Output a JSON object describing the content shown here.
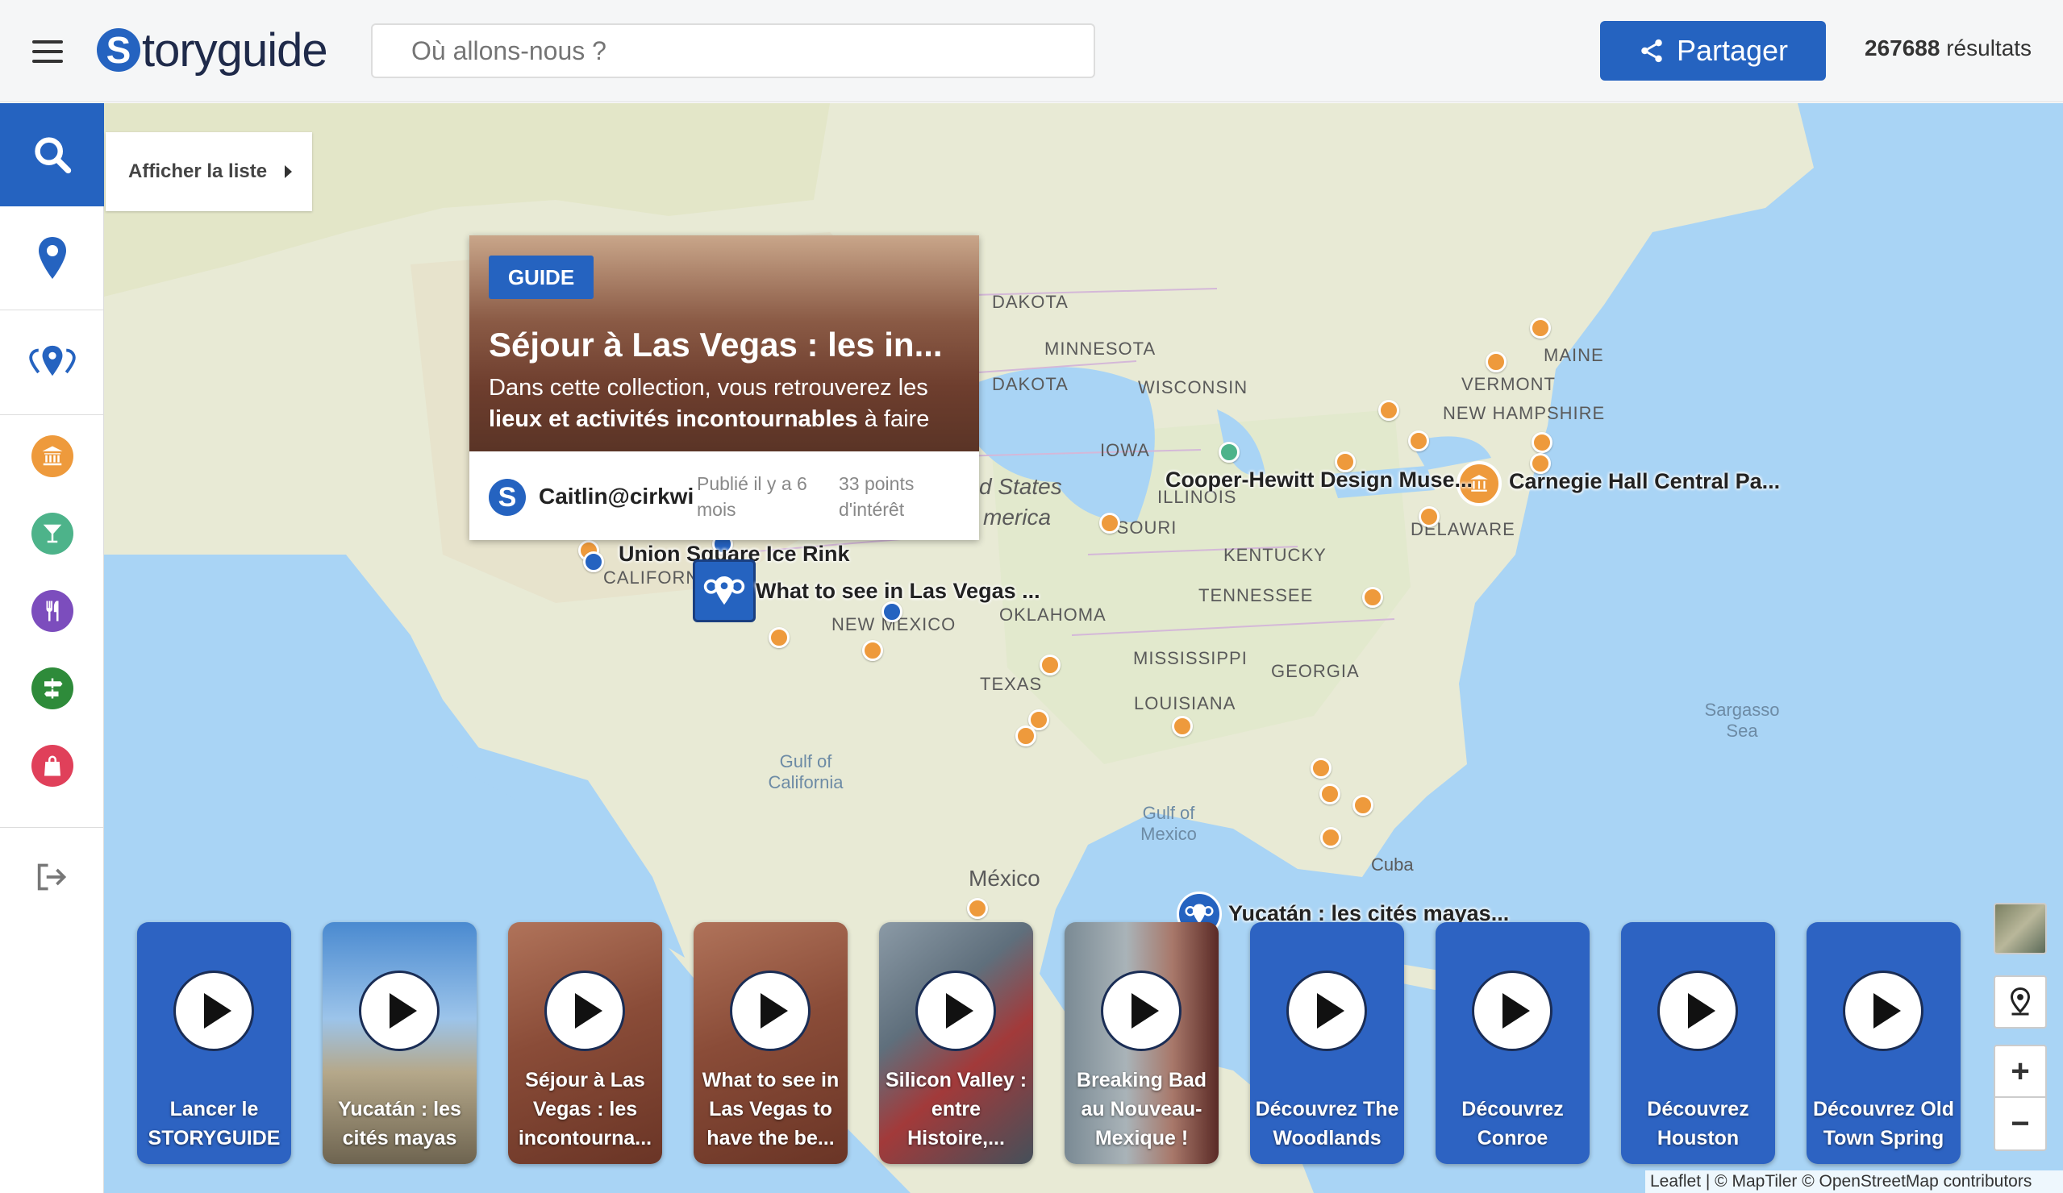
{
  "header": {
    "menu_icon": "hamburger-icon",
    "logo_letter": "S",
    "logo_text": "toryguide",
    "search_placeholder": "Où allons-nous ?",
    "share_label": "Partager",
    "share_icon": "share-icon",
    "results_count": "267688",
    "results_label": "résultats"
  },
  "sidebar": {
    "search_icon": "search-icon",
    "items": [
      {
        "icon": "map-pin-icon"
      },
      {
        "icon": "multi-pin-icon"
      },
      {
        "icon": "museum-icon",
        "color": "#ee9a3c"
      },
      {
        "icon": "cocktail-icon",
        "color": "#4db38a"
      },
      {
        "icon": "restaurant-icon",
        "color": "#7c4dbd"
      },
      {
        "icon": "signpost-icon",
        "color": "#2e8b3a"
      },
      {
        "icon": "shopping-bag-icon",
        "color": "#e0405a"
      },
      {
        "icon": "logout-icon"
      }
    ]
  },
  "map": {
    "list_button": "Afficher la liste",
    "labels": {
      "dakota": "DAKOTA",
      "minnesota": "MINNESOTA",
      "dakota2": "DAKOTA",
      "wisconsin": "WISCONSIN",
      "iowa": "IOWA",
      "maine": "MAINE",
      "vermont": "VERMONT",
      "new_hampshire": "NEW HAMPSHIRE",
      "illinois": "ILLINOIS",
      "delaware": "DELAWARE",
      "missouri": "SSOURI",
      "kentucky": "KENTUCKY",
      "tennessee": "TENNESSEE",
      "oklahoma": "OKLAHOMA",
      "new_mexico": "NEW MEXICO",
      "mississippi": "MISSISSIPPI",
      "georgia": "GEORGIA",
      "texas": "TEXAS",
      "louisiana": "LOUISIANA",
      "california": "CALIFORN",
      "mexico": "México",
      "cuba": "Cuba",
      "united_states": "d States",
      "america": "merica",
      "gulf_california": "Gulf of\nCalifornia",
      "gulf_mexico": "Gulf of\nMexico",
      "sargasso": "Sargasso\nSea"
    },
    "pins": {
      "cooper_hewitt": "Cooper-Hewitt Design Muse...",
      "carnegie": "Carnegie Hall",
      "central_park": "Central Pa...",
      "union_square": "Union Square Ice Rink",
      "las_vegas": "What to see in Las Vegas ...",
      "yucatan": "Yucatán : les cités mayas..."
    }
  },
  "popup": {
    "badge": "GUIDE",
    "title": "Séjour à Las Vegas : les in...",
    "desc_1": "Dans cette collection, vous retrouverez les",
    "desc_bold": "lieux et activités incontournables",
    "desc_2": " à faire",
    "author_letter": "S",
    "author": "Caitlin@cirkwi",
    "published_1": "Publié il y a 6",
    "published_2": "mois",
    "points_1": "33 points",
    "points_2": "d'intérêt"
  },
  "cards": [
    {
      "label": "Lancer le STORYGUIDE",
      "bg": "blue"
    },
    {
      "label": "Yucatán : les cités mayas",
      "bg": "photo-ruins"
    },
    {
      "label": "Séjour à Las Vegas : les incontourna...",
      "bg": "photo-canyon"
    },
    {
      "label": "What to see in Las Vegas to have the be...",
      "bg": "photo-canyon"
    },
    {
      "label": "Silicon Valley : entre Histoire,...",
      "bg": "photo-city"
    },
    {
      "label": "Breaking Bad au Nouveau-Mexique !",
      "bg": "photo-tv"
    },
    {
      "label": "Découvrez The Woodlands",
      "bg": "blue"
    },
    {
      "label": "Découvrez Conroe",
      "bg": "blue"
    },
    {
      "label": "Découvrez Houston",
      "bg": "blue"
    },
    {
      "label": "Découvrez Old Town Spring",
      "bg": "blue"
    }
  ],
  "controls": {
    "layer_icon": "satellite-layer-icon",
    "locate_icon": "locate-icon",
    "zoom_in": "+",
    "zoom_out": "−"
  },
  "attribution": "Leaflet | © MapTiler © OpenStreetMap contributors",
  "colors": {
    "brand": "#2563c0",
    "poi_orange": "#ee9a3c",
    "water": "#a9d4f5",
    "land": "#e9ecd9"
  }
}
